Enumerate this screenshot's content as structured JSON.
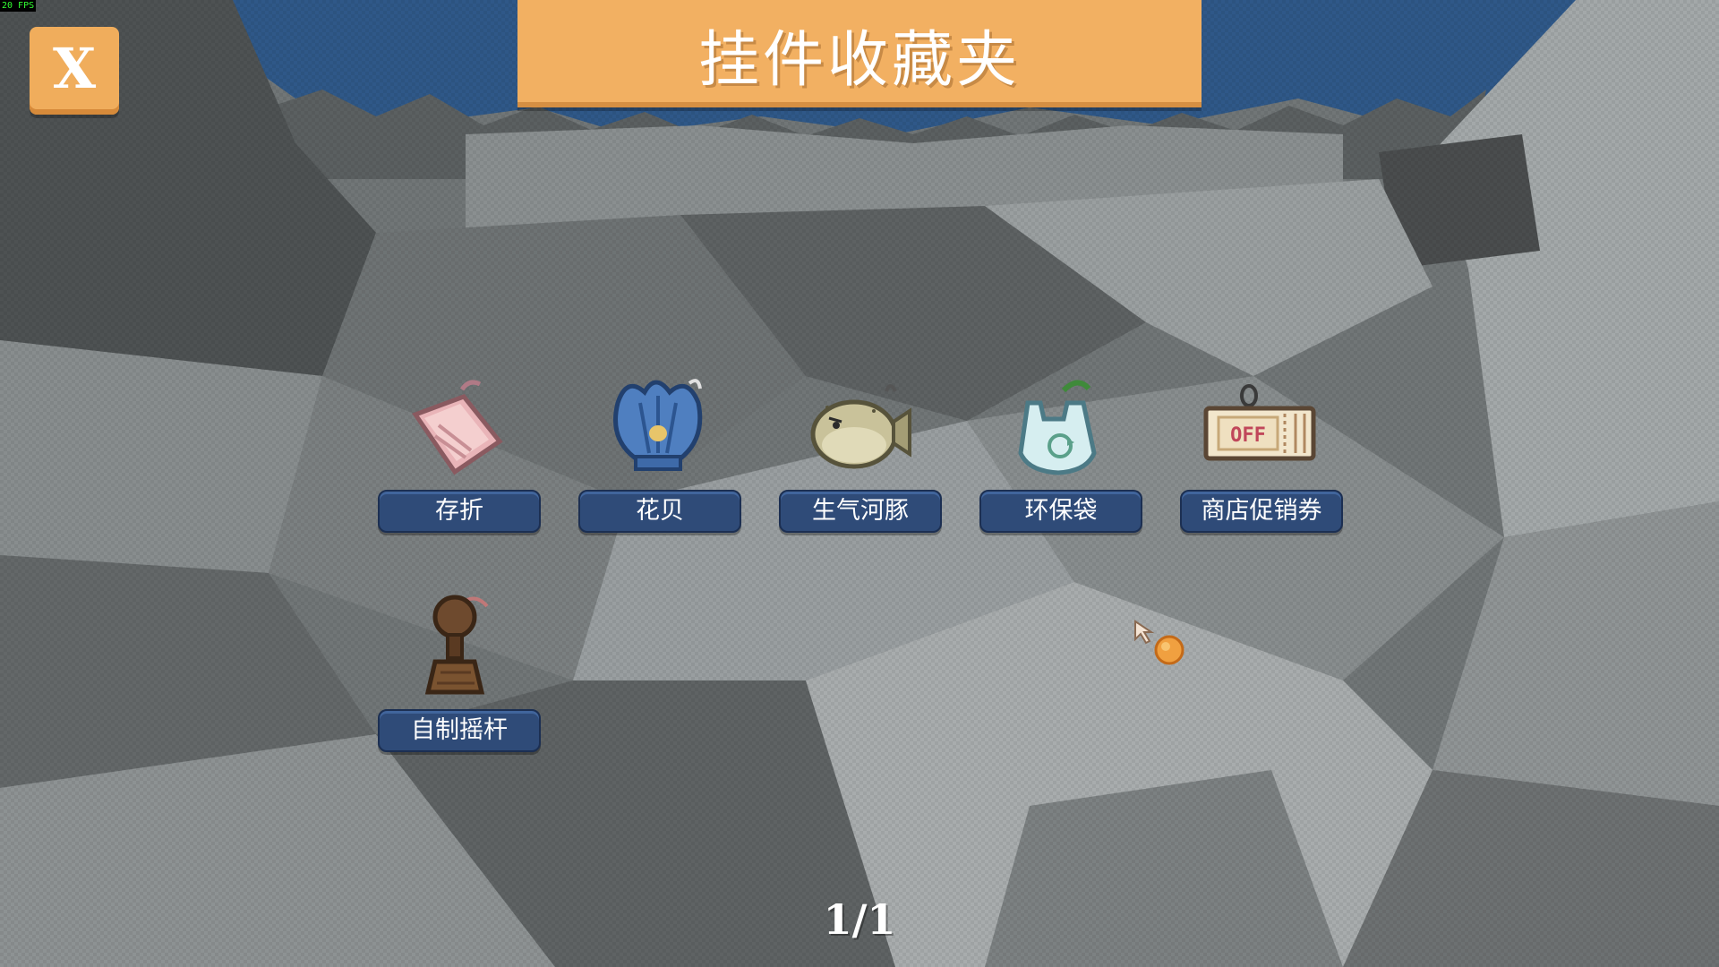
{
  "hud": {
    "fps": "20 FPS"
  },
  "close_button": {
    "label": "X"
  },
  "title": "挂件收藏夹",
  "items": [
    {
      "label": "存折",
      "icon": "pink-passbook-icon"
    },
    {
      "label": "花贝",
      "icon": "blue-scallop-shell-icon"
    },
    {
      "label": "生气河豚",
      "icon": "angry-pufferfish-icon"
    },
    {
      "label": "环保袋",
      "icon": "eco-bag-icon"
    },
    {
      "label": "商店促销券",
      "icon": "shop-coupon-icon",
      "icon_text": "OFF"
    },
    {
      "label": "自制摇杆",
      "icon": "homemade-joystick-icon"
    }
  ],
  "pagination": {
    "text": "1/1"
  },
  "colors": {
    "accent_orange": "#f2b062",
    "label_blue": "#2f4b78",
    "sky_blue": "#2f5888"
  }
}
